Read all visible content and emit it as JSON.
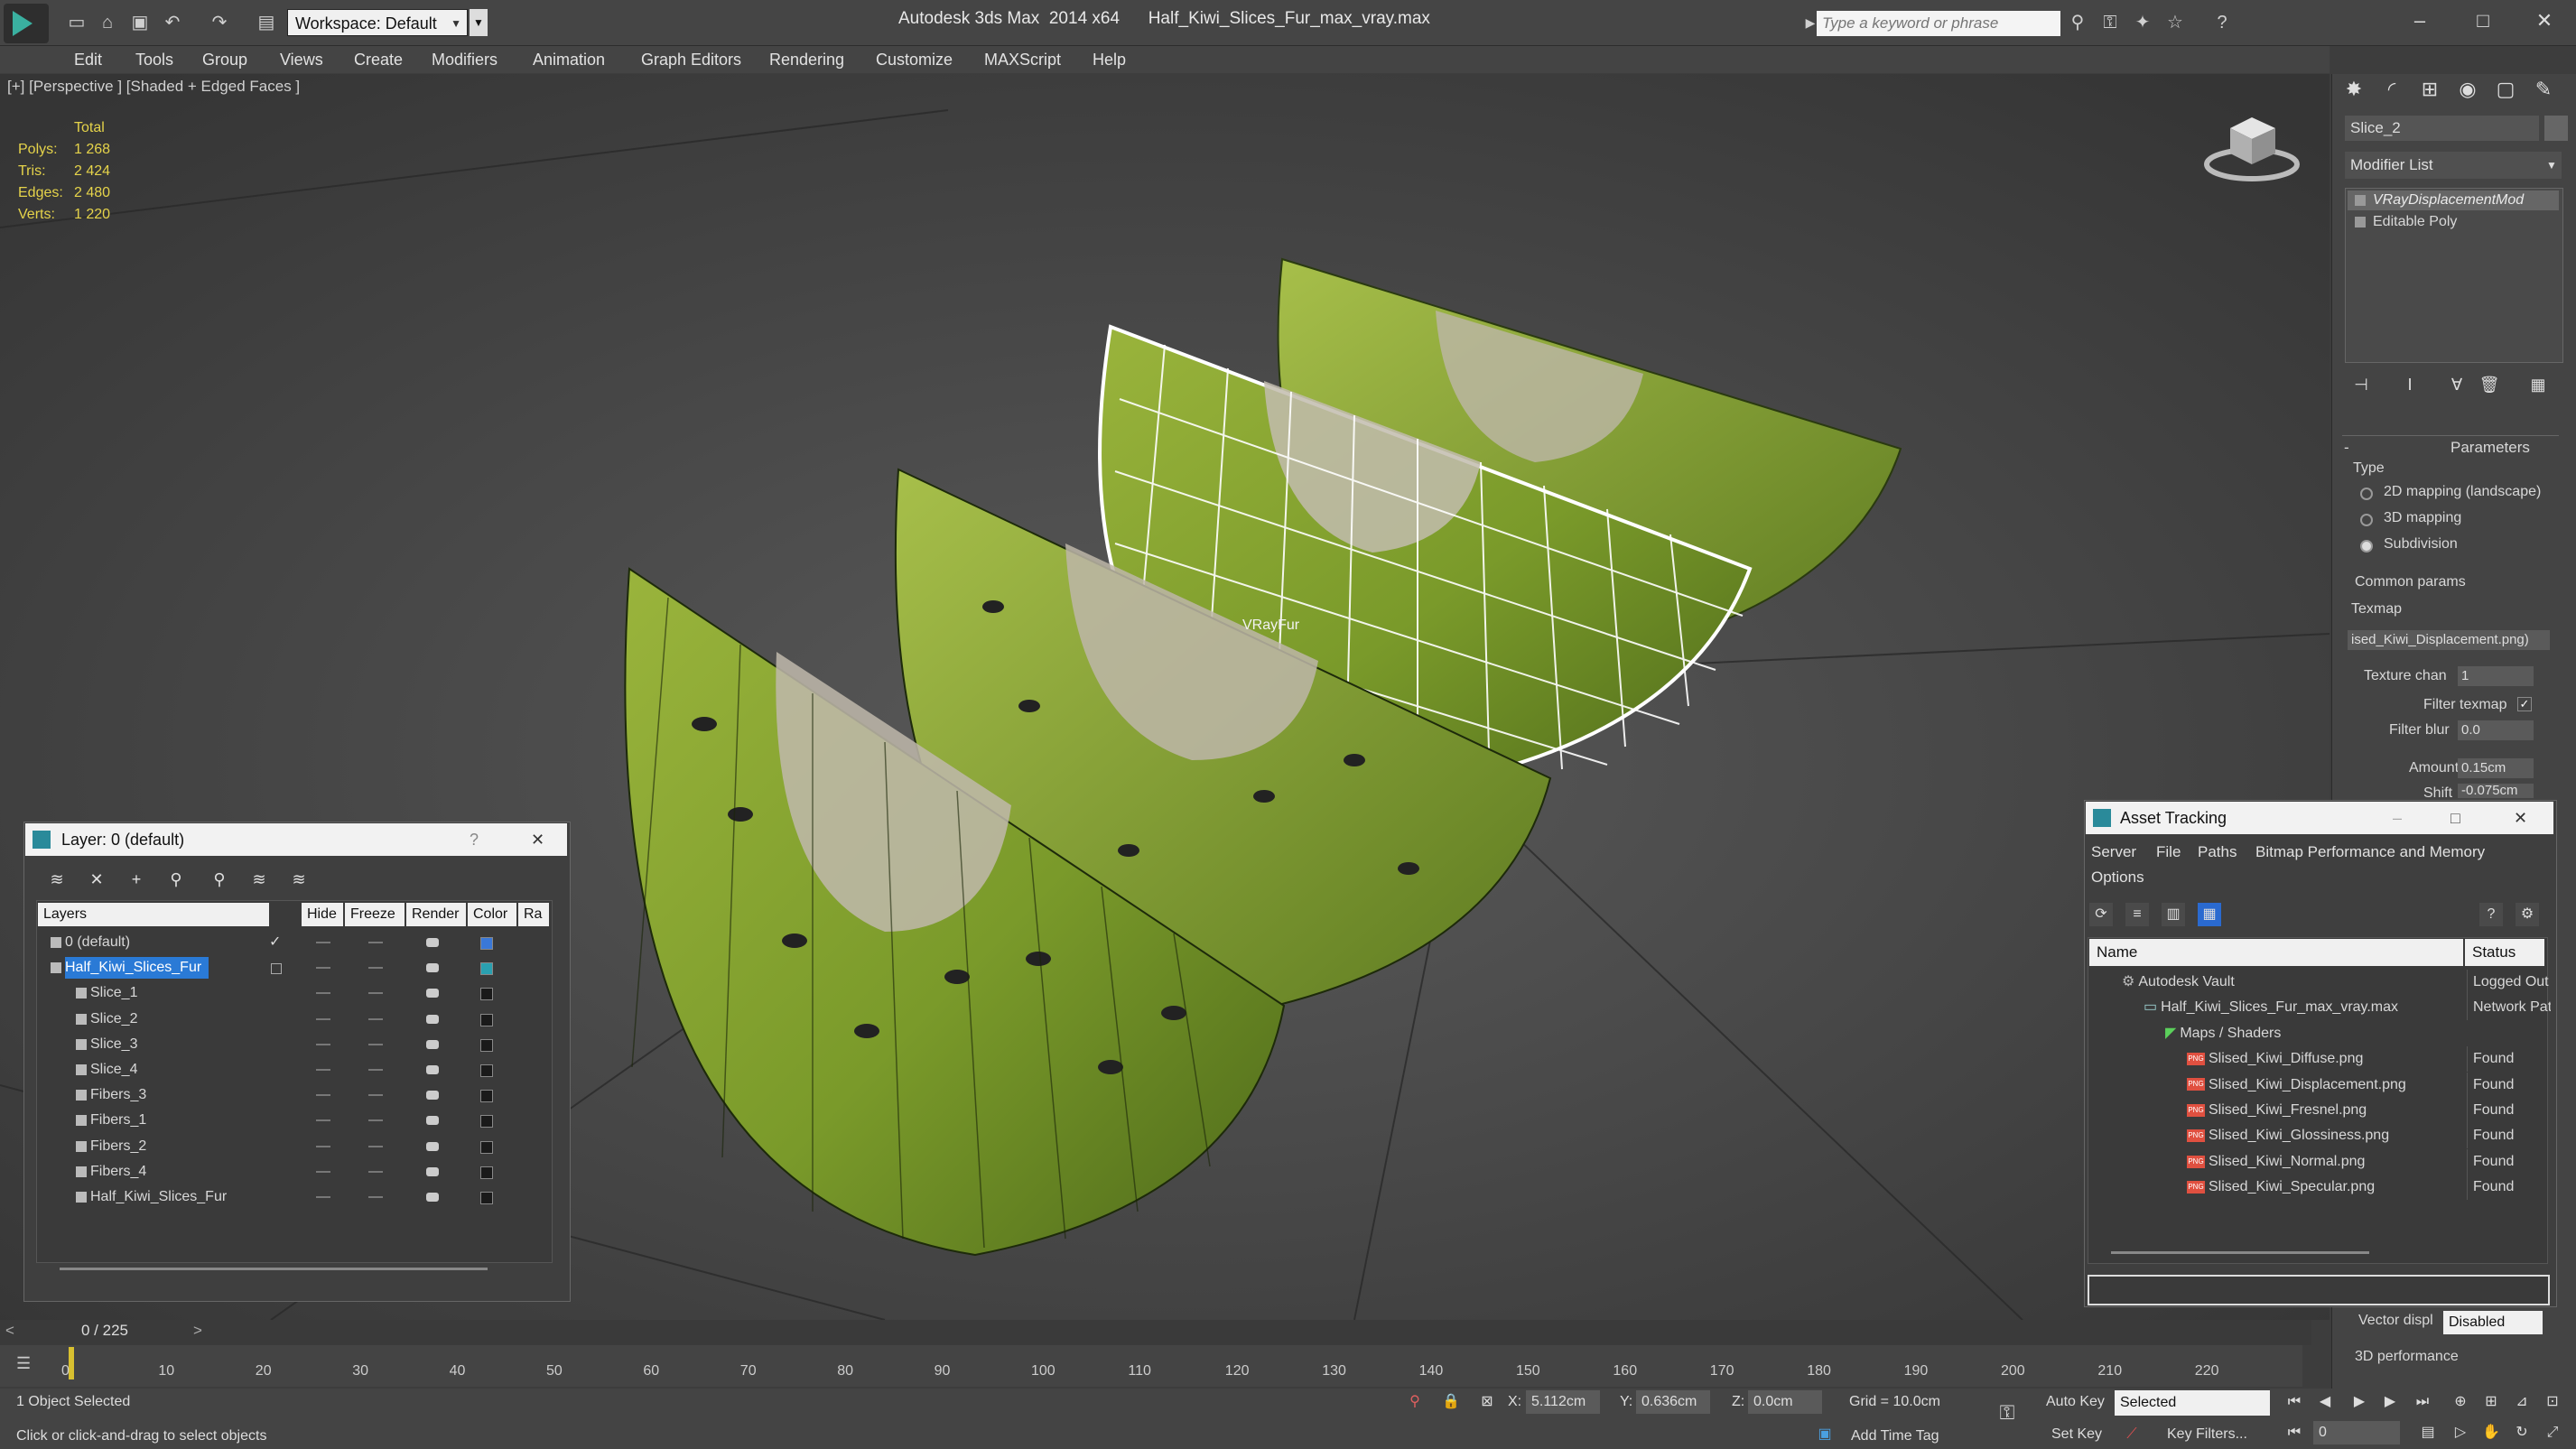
{
  "title_bar": {
    "workspace": "Workspace: Default",
    "app_title": "Autodesk 3ds Max  2014 x64      Half_Kiwi_Slices_Fur_max_vray.max",
    "search_placeholder": "Type a keyword or phrase"
  },
  "menu": [
    "Edit",
    "Tools",
    "Group",
    "Views",
    "Create",
    "Modifiers",
    "Animation",
    "Graph Editors",
    "Rendering",
    "Customize",
    "MAXScript",
    "Help"
  ],
  "viewport": {
    "label": "[+] [Perspective ] [Shaded + Edged Faces ]",
    "stats_header": "Total",
    "stats": [
      {
        "label": "Polys:",
        "value": "1 268"
      },
      {
        "label": "Tris:",
        "value": "2 424"
      },
      {
        "label": "Edges:",
        "value": "2 480"
      },
      {
        "label": "Verts:",
        "value": "1 220"
      }
    ],
    "object_label": "VRayFur"
  },
  "command_panel": {
    "object_name": "Slice_2",
    "modifier_list": "Modifier List",
    "stack": [
      "VRayDisplacementMod",
      "Editable Poly"
    ],
    "parameters_header": "Parameters",
    "type_label": "Type",
    "type_options": [
      "2D mapping (landscape)",
      "3D mapping",
      "Subdivision"
    ],
    "type_selected": "Subdivision",
    "common_params": "Common params",
    "texmap_label": "Texmap",
    "texmap_value": "ised_Kiwi_Displacement.png)",
    "texture_chan_label": "Texture chan",
    "texture_chan_value": "1",
    "filter_texmap_label": "Filter texmap",
    "filter_blur_label": "Filter blur",
    "filter_blur_value": "0.0",
    "amount_label": "Amount",
    "amount_value": "0.15cm",
    "shift_label": "Shift",
    "shift_value": "-0.075cm",
    "vector_displ_label": "Vector displ",
    "vector_displ_value": "Disabled",
    "perf_label": "3D performance"
  },
  "layer_window": {
    "title": "Layer: 0 (default)",
    "help": "?",
    "columns": [
      "Layers",
      "Hide",
      "Freeze",
      "Render",
      "Color",
      "Ra"
    ],
    "rows": [
      {
        "name": "0 (default)",
        "level": 0,
        "checked": true,
        "color": "#3a78d8"
      },
      {
        "name": "Half_Kiwi_Slices_Fur",
        "level": 0,
        "selected": true,
        "color": "#2aa0b0"
      },
      {
        "name": "Slice_1",
        "level": 1,
        "color": "#1a1a1a"
      },
      {
        "name": "Slice_2",
        "level": 1,
        "color": "#1a1a1a"
      },
      {
        "name": "Slice_3",
        "level": 1,
        "color": "#1a1a1a"
      },
      {
        "name": "Slice_4",
        "level": 1,
        "color": "#1a1a1a"
      },
      {
        "name": "Fibers_3",
        "level": 1,
        "color": "#1a1a1a"
      },
      {
        "name": "Fibers_1",
        "level": 1,
        "color": "#1a1a1a"
      },
      {
        "name": "Fibers_2",
        "level": 1,
        "color": "#1a1a1a"
      },
      {
        "name": "Fibers_4",
        "level": 1,
        "color": "#1a1a1a"
      },
      {
        "name": "Half_Kiwi_Slices_Fur",
        "level": 1,
        "color": "#1a1a1a"
      }
    ]
  },
  "asset_window": {
    "title": "Asset Tracking",
    "menus": [
      "Server",
      "File",
      "Paths",
      "Bitmap Performance and Memory",
      "Options"
    ],
    "columns": [
      "Name",
      "Status"
    ],
    "rows": [
      {
        "name": "Autodesk Vault",
        "status": "Logged Out",
        "level": 0,
        "icon": "vault"
      },
      {
        "name": "Half_Kiwi_Slices_Fur_max_vray.max",
        "status": "Network Path",
        "level": 1,
        "icon": "max"
      },
      {
        "name": "Maps / Shaders",
        "status": "",
        "level": 2,
        "icon": "maps"
      },
      {
        "name": "Slised_Kiwi_Diffuse.png",
        "status": "Found",
        "level": 3,
        "icon": "png"
      },
      {
        "name": "Slised_Kiwi_Displacement.png",
        "status": "Found",
        "level": 3,
        "icon": "png"
      },
      {
        "name": "Slised_Kiwi_Fresnel.png",
        "status": "Found",
        "level": 3,
        "icon": "png"
      },
      {
        "name": "Slised_Kiwi_Glossiness.png",
        "status": "Found",
        "level": 3,
        "icon": "png"
      },
      {
        "name": "Slised_Kiwi_Normal.png",
        "status": "Found",
        "level": 3,
        "icon": "png"
      },
      {
        "name": "Slised_Kiwi_Specular.png",
        "status": "Found",
        "level": 3,
        "icon": "png"
      }
    ]
  },
  "timeline": {
    "frame_counter": "0 / 225",
    "ticks": [
      "0",
      "10",
      "20",
      "30",
      "40",
      "50",
      "60",
      "70",
      "80",
      "90",
      "100",
      "110",
      "120",
      "130",
      "140",
      "150",
      "160",
      "170",
      "180",
      "190",
      "200",
      "210",
      "220"
    ]
  },
  "status_bar": {
    "selection": "1 Object Selected",
    "prompt": "Click or click-and-drag to select objects",
    "x_label": "X:",
    "x_value": "5.112cm",
    "y_label": "Y:",
    "y_value": "0.636cm",
    "z_label": "Z:",
    "z_value": "0.0cm",
    "grid": "Grid = 10.0cm",
    "add_time_tag": "Add Time Tag",
    "auto_key": "Auto Key",
    "set_key": "Set Key",
    "selected_dropdown": "Selected",
    "key_filters": "Key Filters...",
    "frame_field": "0"
  }
}
